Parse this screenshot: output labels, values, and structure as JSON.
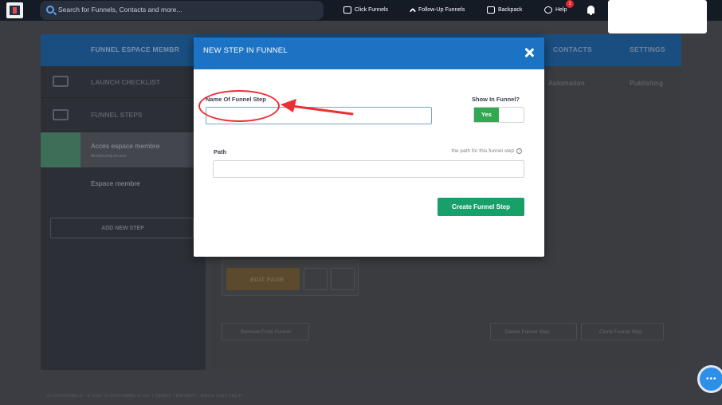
{
  "topbar": {
    "search_placeholder": "Search for Funnels, Contacts and more...",
    "nav": {
      "click_funnels": "Click Funnels",
      "follow_up_funnels": "Follow-Up Funnels",
      "backpack": "Backpack",
      "help": "Help"
    },
    "help_badge": "1"
  },
  "background": {
    "funnel_title": "FUNNEL ESPACE MEMBR",
    "header_tabs": {
      "contacts": "CONTACTS",
      "settings": "SETTINGS"
    },
    "sub_tabs": {
      "automation": "Automation",
      "publishing": "Publishing"
    },
    "sidebar": {
      "launch_checklist": "LAUNCH CHECKLIST",
      "funnel_steps": "FUNNEL STEPS",
      "steps": [
        {
          "name": "Accès espace membre",
          "sub": "Membership Access"
        },
        {
          "name": "Espace membre",
          "sub": ""
        }
      ],
      "add_new_step": "ADD NEW STEP"
    },
    "buttons": {
      "edit_page": "EDIT PAGE",
      "remove_from_funnel": "Remove From Funnel",
      "delete_funnel_step": "Delete Funnel Step",
      "clone_funnel_step": "Clone Funnel Step"
    },
    "footer": "CLICKFUNNELS - © 2020 CLICKFUNNELS LLC   |   TERMS   |   PRIVACY   |   DOCS   |   GET HELP"
  },
  "modal": {
    "title": "NEW STEP IN FUNNEL",
    "name_label": "Name Of Funnel Step",
    "name_value": "",
    "show_label": "Show In Funnel?",
    "show_value": "Yes",
    "path_label": "Path",
    "path_hint": "the path for this funnel step",
    "path_value": "",
    "create_button": "Create Funnel Step"
  },
  "colors": {
    "modal_header": "#1c73c4",
    "create_button": "#18a06a",
    "toggle_on": "#33a853",
    "annotation": "#ec2f35"
  }
}
